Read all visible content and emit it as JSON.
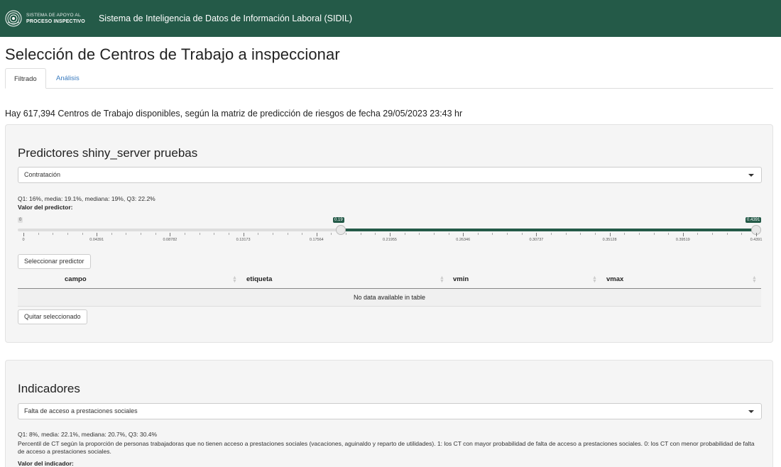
{
  "navbar": {
    "logo_line1": "SISTEMA DE APOYO AL",
    "logo_line2": "PROCESO INSPECTIVO",
    "title": "Sistema de Inteligencia de Datos de Información Laboral (SIDIL)"
  },
  "page": {
    "title": "Selección de Centros de Trabajo a inspeccionar",
    "availability_text": "Hay 617,394 Centros de Trabajo disponibles, según la matriz de predicción de riesgos de fecha 29/05/2023 23:43 hr"
  },
  "tabs": [
    {
      "label": "Filtrado",
      "active": true
    },
    {
      "label": "Análisis",
      "active": false
    }
  ],
  "predictores": {
    "heading": "Predictores shiny_server pruebas",
    "select_value": "Contratación",
    "stats": "Q1: 16%, media: 19.1%, mediana: 19%, Q3: 22.2%",
    "slider_label": "Valor del predictor:",
    "slider": {
      "min_label": "0",
      "low_label": "0.19",
      "high_label": "0.4391",
      "min": 0,
      "max": 0.4391,
      "low": 0.19,
      "high": 0.4391,
      "tick_labels": [
        "0",
        "0.04391",
        "0.08782",
        "0.13173",
        "0.17564",
        "0.21955",
        "0.26346",
        "0.30737",
        "0.35128",
        "0.39519",
        "0.4391"
      ]
    },
    "select_button": "Seleccionar predictor",
    "table": {
      "columns": [
        "campo",
        "etiqueta",
        "vmin",
        "vmax"
      ],
      "empty_message": "No data available in table"
    },
    "remove_button": "Quitar seleccionado"
  },
  "indicadores": {
    "heading": "Indicadores",
    "select_value": "Falta de acceso a prestaciones sociales",
    "stats": "Q1: 8%, media: 22.1%, mediana: 20.7%, Q3: 30.4%",
    "description": "Percentil de CT según la proporción de personas trabajadoras que no tienen acceso a prestaciones sociales (vacaciones, aguinaldo y reparto de utilidades). 1: los CT con mayor probabilidad de falta de acceso a prestaciones sociales. 0: los CT con menor probabilidad de falta de acceso a prestaciones sociales.",
    "slider_label": "Valor del indicador:"
  },
  "colors": {
    "brand_green": "#245a48",
    "link_blue": "#3a7bbf"
  }
}
